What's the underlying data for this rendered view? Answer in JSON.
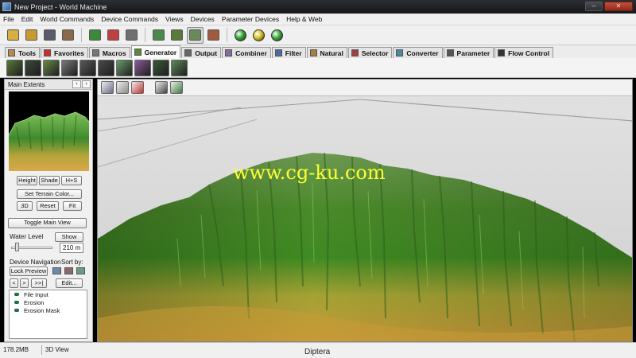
{
  "window": {
    "title": "New Project - World Machine"
  },
  "menu": [
    "File",
    "Edit",
    "World Commands",
    "Device Commands",
    "Views",
    "Devices",
    "Parameter Devices",
    "Help & Web"
  ],
  "toolbar": {
    "buttons": [
      "new-project-icon",
      "open-project-icon",
      "save-project-icon",
      "preferences-icon",
      "build-terrain-icon",
      "export-icon",
      "random-seed-icon",
      "device-view-icon",
      "layout-view-icon",
      "3d-view-icon",
      "explorer-view-icon"
    ],
    "orbs": [
      {
        "name": "build-green-orb-icon",
        "color": "#2fa52f"
      },
      {
        "name": "build-yellow-orb-icon",
        "color": "#d8c21c"
      },
      {
        "name": "build-tiles-orb-icon",
        "color": "#3aa83a"
      }
    ]
  },
  "tabs": [
    {
      "label": "Tools",
      "icon": "tools-icon",
      "color": "#b88a4a"
    },
    {
      "label": "Favorites",
      "icon": "heart-icon",
      "color": "#c83030"
    },
    {
      "label": "Macros",
      "icon": "macros-icon",
      "color": "#777777"
    },
    {
      "label": "Generator",
      "icon": "generator-icon",
      "color": "#5a8a3a"
    },
    {
      "label": "Output",
      "icon": "output-icon",
      "color": "#666666"
    },
    {
      "label": "Combiner",
      "icon": "combiner-icon",
      "color": "#8a6a9a"
    },
    {
      "label": "Filter",
      "icon": "filter-icon",
      "color": "#4a6aa0"
    },
    {
      "label": "Natural",
      "icon": "natural-icon",
      "color": "#a08040"
    },
    {
      "label": "Selector",
      "icon": "selector-icon",
      "color": "#a04040"
    },
    {
      "label": "Converter",
      "icon": "converter-icon",
      "color": "#4a8aa0"
    },
    {
      "label": "Parameter",
      "icon": "parameter-icon",
      "color": "#555555"
    },
    {
      "label": "Flow Control",
      "icon": "flow-control-icon",
      "color": "#333333"
    }
  ],
  "active_tab": "Generator",
  "generator_devices": [
    {
      "name": "advanced-perlin-device-icon",
      "color": "#5a7a3a"
    },
    {
      "name": "perlin-noise-device-icon",
      "color": "#3a4a3a"
    },
    {
      "name": "voronoi-device-icon",
      "color": "#6a8a4a"
    },
    {
      "name": "constant-device-icon",
      "color": "#7a7a7a"
    },
    {
      "name": "gradient-device-icon",
      "color": "#5a5a5a"
    },
    {
      "name": "radial-gradient-device-icon",
      "color": "#4a4a4a"
    },
    {
      "name": "layout-generator-device-icon",
      "color": "#6a9a6a"
    },
    {
      "name": "color-generator-device-icon",
      "color": "#8a5a9a"
    },
    {
      "name": "file-input-device-icon",
      "color": "#3a5a3a"
    },
    {
      "name": "tiled-input-device-icon",
      "color": "#5a8a5a"
    }
  ],
  "left_panel": {
    "title": "Main Extents",
    "buttons": {
      "height": "Height",
      "shade": "Shade",
      "hs": "H+S",
      "set_terrain_color": "Set Terrain Color...",
      "three_d": "3D",
      "reset": "Reset",
      "fit": "Fit",
      "toggle_main_view": "Toggle Main View",
      "show": "Show",
      "lock_preview": "Lock Preview",
      "edit": "Edit..."
    },
    "water_level_label": "Water Level",
    "water_level_value": "210 m",
    "water_level_fraction": 0.1,
    "device_navigation_label": "Device Navigation",
    "sort_by_label": "Sort by:",
    "nav_arrows": [
      "<",
      ">",
      ">>|"
    ],
    "devices": [
      "File Input",
      "Erosion",
      "Erosion Mask"
    ]
  },
  "viewport": {
    "toolbar_icons": [
      {
        "name": "camera-icon",
        "color": "#6a6a8a"
      },
      {
        "name": "render-icon",
        "color": "#8a8a8a"
      },
      {
        "name": "stop-icon",
        "color": "#c03030"
      },
      {
        "name": "screenshot-icon",
        "color": "#444444"
      },
      {
        "name": "line-tool-icon",
        "color": "#3a7a3a"
      }
    ],
    "watermark": "www.cg-ku.com"
  },
  "status": {
    "memory": "178.2MB",
    "view": "3D View",
    "caption": "Diptera"
  },
  "colors": {
    "title_bg": "#1e2124",
    "terrain_green": "#4f8a2c",
    "terrain_yellow": "#c8a53a",
    "sky": "#d8d8d8"
  }
}
